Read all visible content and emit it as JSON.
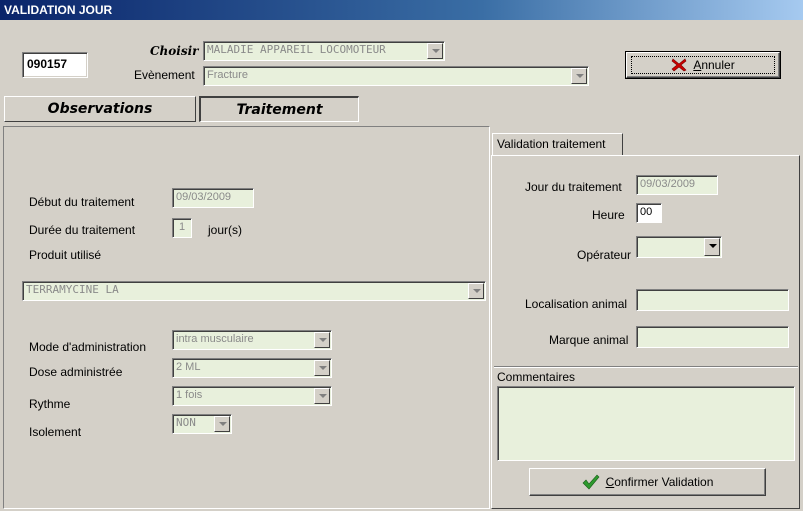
{
  "window": {
    "title": "VALIDATION JOUR"
  },
  "header": {
    "code": "090157",
    "choisir_label": "Choisir",
    "choisir_value": "MALADIE APPAREIL LOCOMOTEUR",
    "evenement_label": "Evènement",
    "evenement_value": "Fracture",
    "annuler_prefix": "",
    "annuler_underline": "A",
    "annuler_rest": "nnuler"
  },
  "tabs": {
    "observations": "Observations",
    "traitement": "Traitement"
  },
  "left": {
    "debut_label": "Début du traitement",
    "debut_value": "09/03/2009",
    "duree_label": "Durée du traitement",
    "duree_value": "1",
    "duree_unit": "jour(s)",
    "produit_label": "Produit utilisé",
    "produit_value": "TERRAMYCINE LA",
    "mode_label": "Mode d'administration",
    "mode_value": "intra musculaire",
    "dose_label": "Dose administrée",
    "dose_value": "2 ML",
    "rythme_label": "Rythme",
    "rythme_value": "1 fois",
    "isolement_label": "Isolement",
    "isolement_value": "NON"
  },
  "right": {
    "tab_label": "Validation traitement",
    "jour_label": "Jour du traitement",
    "jour_value": "09/03/2009",
    "heure_label": "Heure",
    "heure_value": "00",
    "operateur_label": "Opérateur",
    "operateur_value": "",
    "localisation_label": "Localisation animal",
    "localisation_value": "",
    "marque_label": "Marque animal",
    "marque_value": "",
    "commentaires_label": "Commentaires",
    "commentaires_value": "",
    "confirm_underline": "C",
    "confirm_rest": "onfirmer Validation"
  },
  "colors": {
    "field_green": "#e8f0dc",
    "window_bg": "#d4d0c8",
    "title_blue": "#0a246a",
    "cancel_red": "#cc0000",
    "confirm_green": "#2e9a2e"
  }
}
